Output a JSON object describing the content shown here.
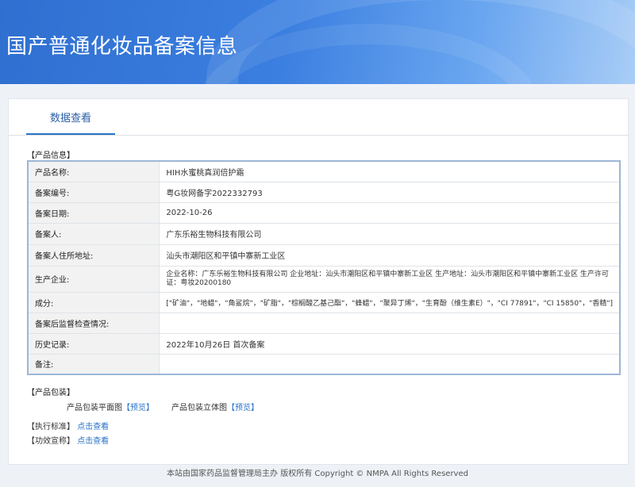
{
  "banner": {
    "title": "国产普通化妆品备案信息"
  },
  "tabs": [
    {
      "label": "数据查看"
    }
  ],
  "product_info": {
    "section_label": "【产品信息】",
    "rows": [
      {
        "key": "产品名称:",
        "value": "HIH水蜜桃真润倍护霜"
      },
      {
        "key": "备案编号:",
        "value": "粤G妆网备字2022332793"
      },
      {
        "key": "备案日期:",
        "value": "2022-10-26"
      },
      {
        "key": "备案人:",
        "value": "广东乐裕生物科技有限公司"
      },
      {
        "key": "备案人住所地址:",
        "value": "汕头市潮阳区和平镇中寨新工业区"
      },
      {
        "key": "生产企业:",
        "value": "企业名称：广东乐裕生物科技有限公司 企业地址：汕头市潮阳区和平镇中寨新工业区 生产地址：汕头市潮阳区和平镇中寨新工业区 生产许可证：粤妆20200180"
      },
      {
        "key": "成分:",
        "value": "[\"矿油\"，\"地蜡\"，\"角鲨烷\"，\"矿脂\"，\"棕榈酸乙基己酯\"，\"蜂蜡\"，\"聚异丁烯\"，\"生育酚（维生素E）\"，\"CI 77891\"，\"CI 15850\"，\"香精\"]"
      },
      {
        "key": "备案后监督检查情况:",
        "value": ""
      },
      {
        "key": "历史记录:",
        "value": "2022年10月26日 首次备案"
      },
      {
        "key": "备注:",
        "value": ""
      }
    ]
  },
  "packaging": {
    "section_label": "【产品包装】",
    "flat_label": "产品包装平面图",
    "flat_link": "【预览】",
    "stereo_label": "产品包装立体图",
    "stereo_link": "【预览】"
  },
  "standard": {
    "label": "【执行标准】",
    "link": "点击查看"
  },
  "efficacy": {
    "label": "【功效宣称】",
    "link": "点击查看"
  },
  "footer": {
    "text": "本站由国家药品监督管理局主办 版权所有 Copyright © NMPA All Rights Reserved"
  }
}
